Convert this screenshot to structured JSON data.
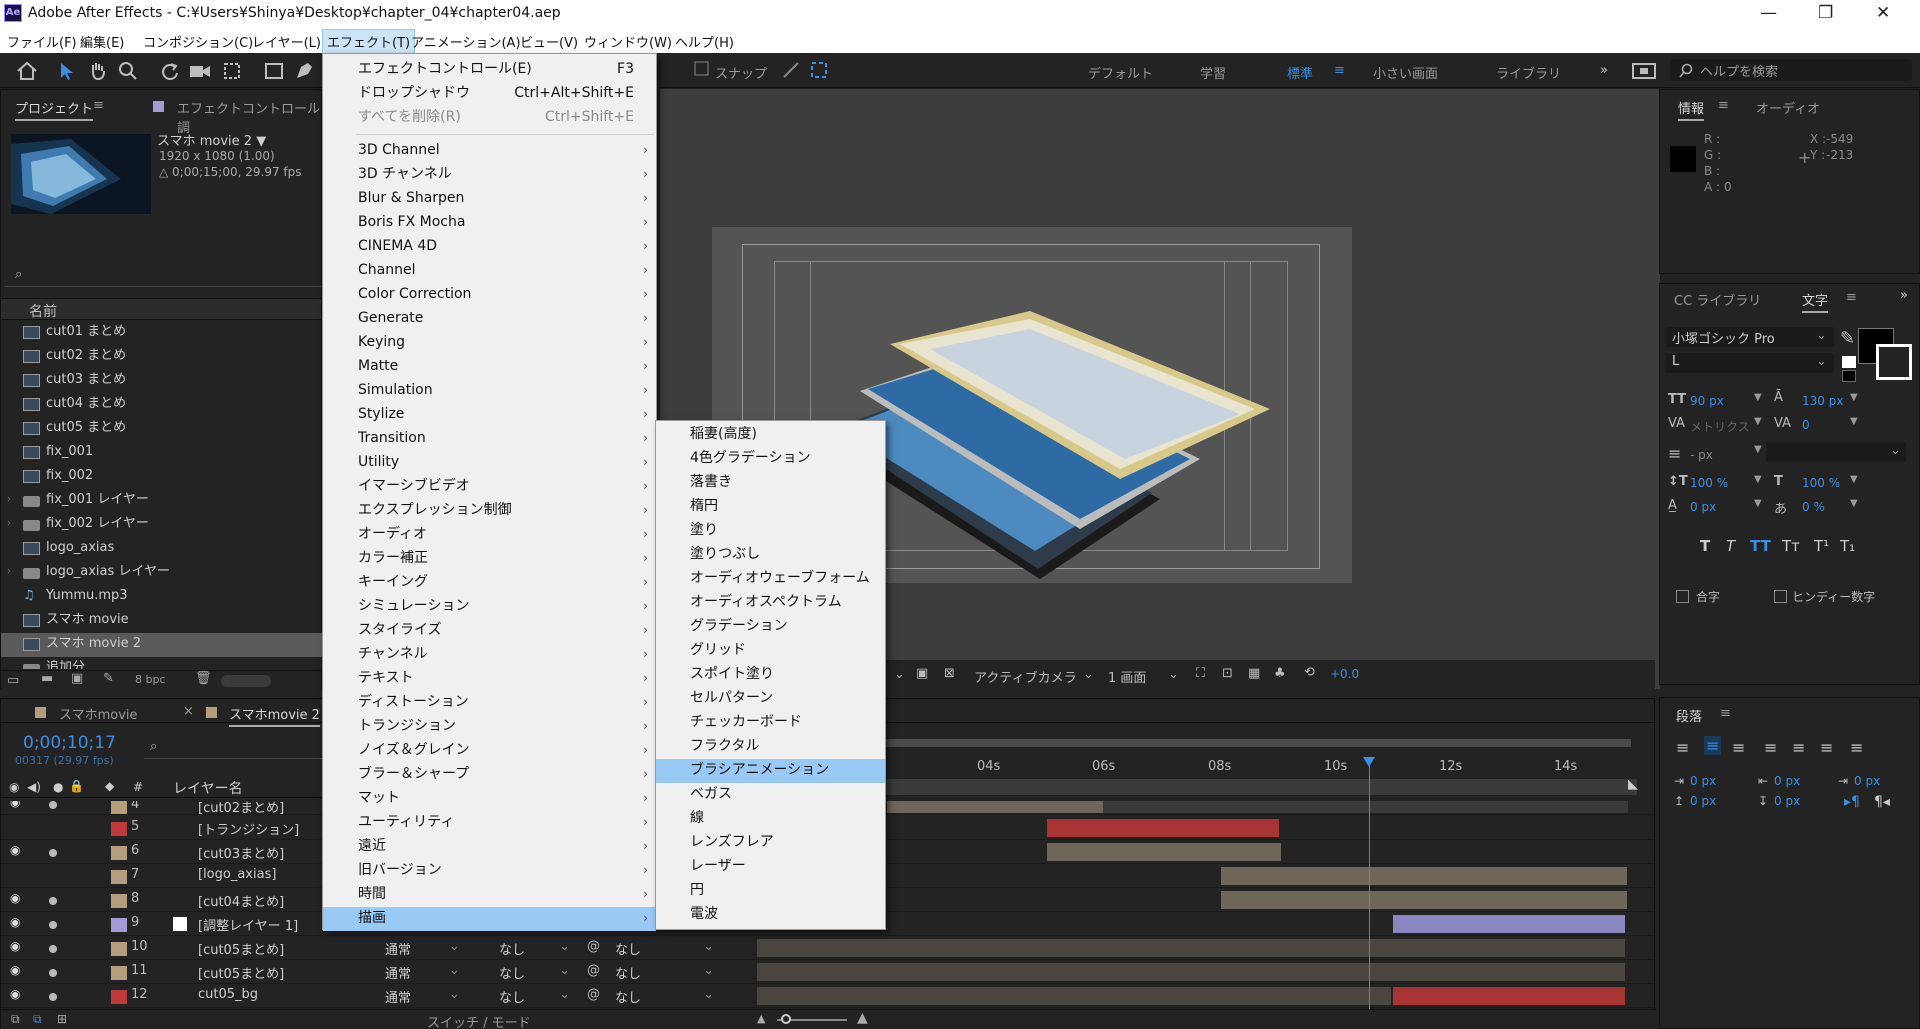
{
  "window": {
    "title": "Adobe After Effects - C:¥Users¥Shinya¥Desktop¥chapter_04¥chapter04.aep",
    "app_icon": "Ae",
    "controls": {
      "minimize": "—",
      "restore": "❐",
      "close": "✕"
    }
  },
  "menubar": [
    {
      "label": "ファイル(F)"
    },
    {
      "label": "編集(E)"
    },
    {
      "label": "コンポジション(C)"
    },
    {
      "label": "レイヤー(L)"
    },
    {
      "label": "エフェクト(T)",
      "active": true
    },
    {
      "label": "アニメーション(A)"
    },
    {
      "label": "ビュー(V)"
    },
    {
      "label": "ウィンドウ(W)"
    },
    {
      "label": "ヘルプ(H)"
    }
  ],
  "toolbar": {
    "snap_label": "スナップ",
    "workspaces": [
      "デフォルト",
      "学習",
      "標準",
      "小さい画面",
      "ライブラリ"
    ],
    "active_workspace": "標準",
    "help_placeholder": "ヘルプを検索"
  },
  "project_panel": {
    "tab_project": "プロジェクト",
    "tab_effect_controls": "エフェクトコントロール 調",
    "comp_name": "スマホ movie 2 ▼",
    "comp_size": "1920 x 1080 (1.00)",
    "comp_duration": "△ 0;00;15;00, 29.97 fps",
    "search_icon": "⌕",
    "column_name": "名前",
    "items": [
      {
        "name": "cut01 まとめ",
        "type": "comp"
      },
      {
        "name": "cut02 まとめ",
        "type": "comp"
      },
      {
        "name": "cut03 まとめ",
        "type": "comp"
      },
      {
        "name": "cut04 まとめ",
        "type": "comp"
      },
      {
        "name": "cut05 まとめ",
        "type": "comp"
      },
      {
        "name": "fix_001",
        "type": "comp"
      },
      {
        "name": "fix_002",
        "type": "comp"
      },
      {
        "name": "fix_001 レイヤー",
        "type": "folder"
      },
      {
        "name": "fix_002 レイヤー",
        "type": "folder"
      },
      {
        "name": "logo_axias",
        "type": "comp"
      },
      {
        "name": "logo_axias レイヤー",
        "type": "folder"
      },
      {
        "name": "Yummu.mp3",
        "type": "audio"
      },
      {
        "name": "スマホ movie",
        "type": "comp"
      },
      {
        "name": "スマホ movie 2",
        "type": "comp",
        "selected": true
      },
      {
        "name": "追加分",
        "type": "folder"
      }
    ],
    "bpc": "8 bpc"
  },
  "effect_menu": {
    "top_items": [
      {
        "label": "エフェクトコントロール(E)",
        "shortcut": "F3"
      },
      {
        "label": "ドロップシャドウ",
        "shortcut": "Ctrl+Alt+Shift+E"
      },
      {
        "label": "すべてを削除(R)",
        "shortcut": "Ctrl+Shift+E",
        "disabled": true
      }
    ],
    "categories": [
      "3D Channel",
      "3D チャンネル",
      "Blur & Sharpen",
      "Boris FX Mocha",
      "CINEMA 4D",
      "Channel",
      "Color Correction",
      "Generate",
      "Keying",
      "Matte",
      "Simulation",
      "Stylize",
      "Transition",
      "Utility",
      "イマーシブビデオ",
      "エクスプレッション制御",
      "オーディオ",
      "カラー補正",
      "キーイング",
      "シミュレーション",
      "スタイライズ",
      "チャンネル",
      "テキスト",
      "ディストーション",
      "トランジション",
      "ノイズ＆グレイン",
      "ブラー＆シャープ",
      "マット",
      "ユーティリティ",
      "遠近",
      "旧バージョン",
      "時間",
      "描画"
    ],
    "highlighted": "描画"
  },
  "draw_submenu": {
    "items": [
      "稲妻(高度)",
      "4色グラデーション",
      "落書き",
      "楕円",
      "塗り",
      "塗りつぶし",
      "オーディオウェーブフォーム",
      "オーディオスペクトラム",
      "グラデーション",
      "グリッド",
      "スポイト塗り",
      "セルパターン",
      "チェッカーボード",
      "フラクタル",
      "ブラシアニメーション",
      "ベガス",
      "線",
      "レンズフレア",
      "レーザー",
      "円",
      "電波"
    ],
    "highlighted": "ブラシアニメーション"
  },
  "viewer": {
    "camera": "アクティブカメラ",
    "views": "1 画面",
    "exposure": "+0.0"
  },
  "info_panel": {
    "tab_info": "情報",
    "tab_audio": "オーディオ",
    "r_label": "R :",
    "g_label": "G :",
    "b_label": "B :",
    "a_label": "A :",
    "a_value": "0",
    "x_label": "X :",
    "x_value": "-549",
    "y_label": "Y :",
    "y_value": "-213"
  },
  "character_panel": {
    "tab_library": "CC ライブラリ",
    "tab_character": "文字",
    "font_family": "小塚ゴシック Pro",
    "font_style": "L",
    "font_size": "90 px",
    "leading": "130 px",
    "kerning": "メトリクス",
    "tracking": "0",
    "stroke_width": "- px",
    "vscale": "100 %",
    "hscale": "100 %",
    "baseline": "0 px",
    "tsume": "0 %",
    "styles": [
      "T",
      "T",
      "TT",
      "Tт",
      "T¹",
      "T₁"
    ],
    "ligature_label": "合字",
    "hindi_label": "ヒンディー数字"
  },
  "paragraph_panel": {
    "tab": "段落",
    "indent_values": [
      "0 px",
      "0 px",
      "0 px",
      "0 px",
      "0 px"
    ]
  },
  "timeline": {
    "tabs": [
      {
        "label": "スマホmovie",
        "active": false
      },
      {
        "label": "スマホmovie 2",
        "active": true
      }
    ],
    "timecode": "0;00;10;17",
    "frame_info": "00317 (29.97 fps)",
    "column_layer_name": "レイヤー名",
    "ruler_ticks": [
      "04s",
      "06s",
      "08s",
      "10s",
      "12s",
      "14s"
    ],
    "switch_mode_label": "スイッチ / モード",
    "layers": [
      {
        "num": "4",
        "name": "[cut02まとめ]",
        "color": "#b39e7e",
        "mode": "",
        "track": "",
        "parent": ""
      },
      {
        "num": "5",
        "name": "[トランジション]",
        "color": "#c03a3a",
        "mode": "",
        "track": "",
        "parent": ""
      },
      {
        "num": "6",
        "name": "[cut03まとめ]",
        "color": "#b39e7e",
        "mode": "",
        "track": "",
        "parent": ""
      },
      {
        "num": "7",
        "name": "[logo_axias]",
        "color": "#b39e7e",
        "mode": "",
        "track": "",
        "parent": ""
      },
      {
        "num": "8",
        "name": "[cut04まとめ]",
        "color": "#b39e7e",
        "mode": "",
        "track": "",
        "parent": ""
      },
      {
        "num": "9",
        "name": "[調整レイヤー 1]",
        "color": "#a59ad6",
        "mode": "",
        "track": "",
        "parent": ""
      },
      {
        "num": "10",
        "name": "[cut05まとめ]",
        "color": "#b39e7e",
        "mode": "通常",
        "track": "なし",
        "parent": "なし"
      },
      {
        "num": "11",
        "name": "[cut05まとめ]",
        "color": "#b39e7e",
        "mode": "通常",
        "track": "なし",
        "parent": "なし"
      },
      {
        "num": "12",
        "name": "cut05_bg",
        "color": "#c03a3a",
        "mode": "通常",
        "track": "なし",
        "parent": "なし"
      }
    ]
  },
  "colors": {
    "accent_blue": "#3a8ee6",
    "menu_highlight": "#99c9f5",
    "panel_bg": "#232323",
    "layer_tan": "#6e6658",
    "layer_red": "#a83434",
    "layer_purple": "#8a86c0"
  }
}
